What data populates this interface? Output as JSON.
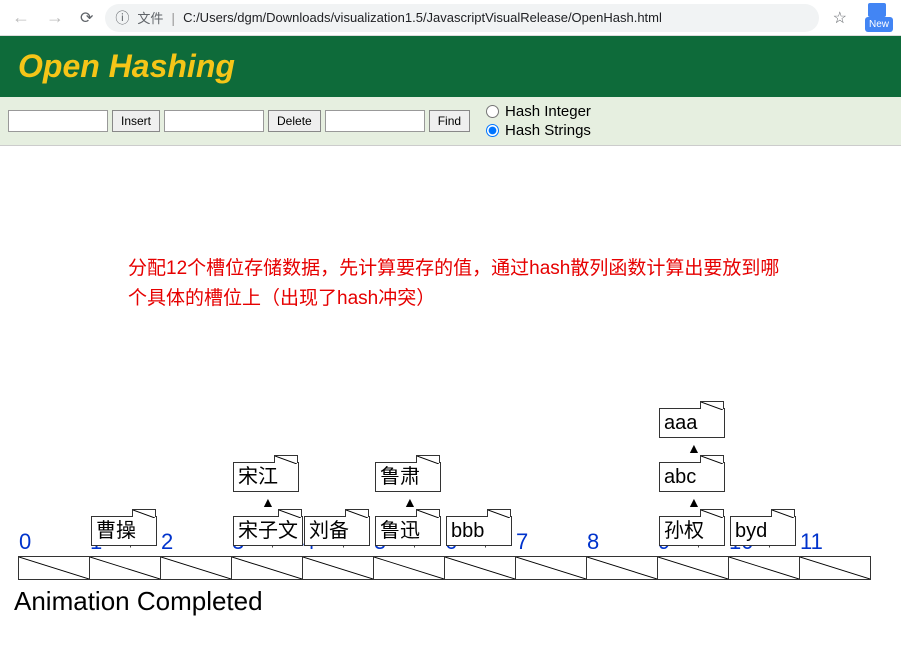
{
  "browser": {
    "url_prefix": "文件",
    "url": "C:/Users/dgm/Downloads/visualization1.5/JavascriptVisualRelease/OpenHash.html",
    "new_label": "New"
  },
  "title": "Open Hashing",
  "controls": {
    "insert_label": "Insert",
    "delete_label": "Delete",
    "find_label": "Find",
    "radio1": "Hash Integer",
    "radio2": "Hash Strings"
  },
  "annotation": "分配12个槽位存储数据，先计算要存的值，通过hash散列函数计算出要放到哪个具体的槽位上（出现了hash冲突）",
  "slots": [
    "0",
    "1",
    "2",
    "3",
    "4",
    "5",
    "6",
    "7",
    "8",
    "9",
    "10",
    "11"
  ],
  "chains": {
    "1": [
      "曹操"
    ],
    "3": [
      "宋子文",
      "宋江"
    ],
    "4": [
      "刘备"
    ],
    "5": [
      "鲁迅",
      "鲁肃"
    ],
    "6": [
      "bbb"
    ],
    "9": [
      "孙权",
      "abc",
      "aaa"
    ],
    "10": [
      "byd"
    ]
  },
  "status": "Animation Completed"
}
